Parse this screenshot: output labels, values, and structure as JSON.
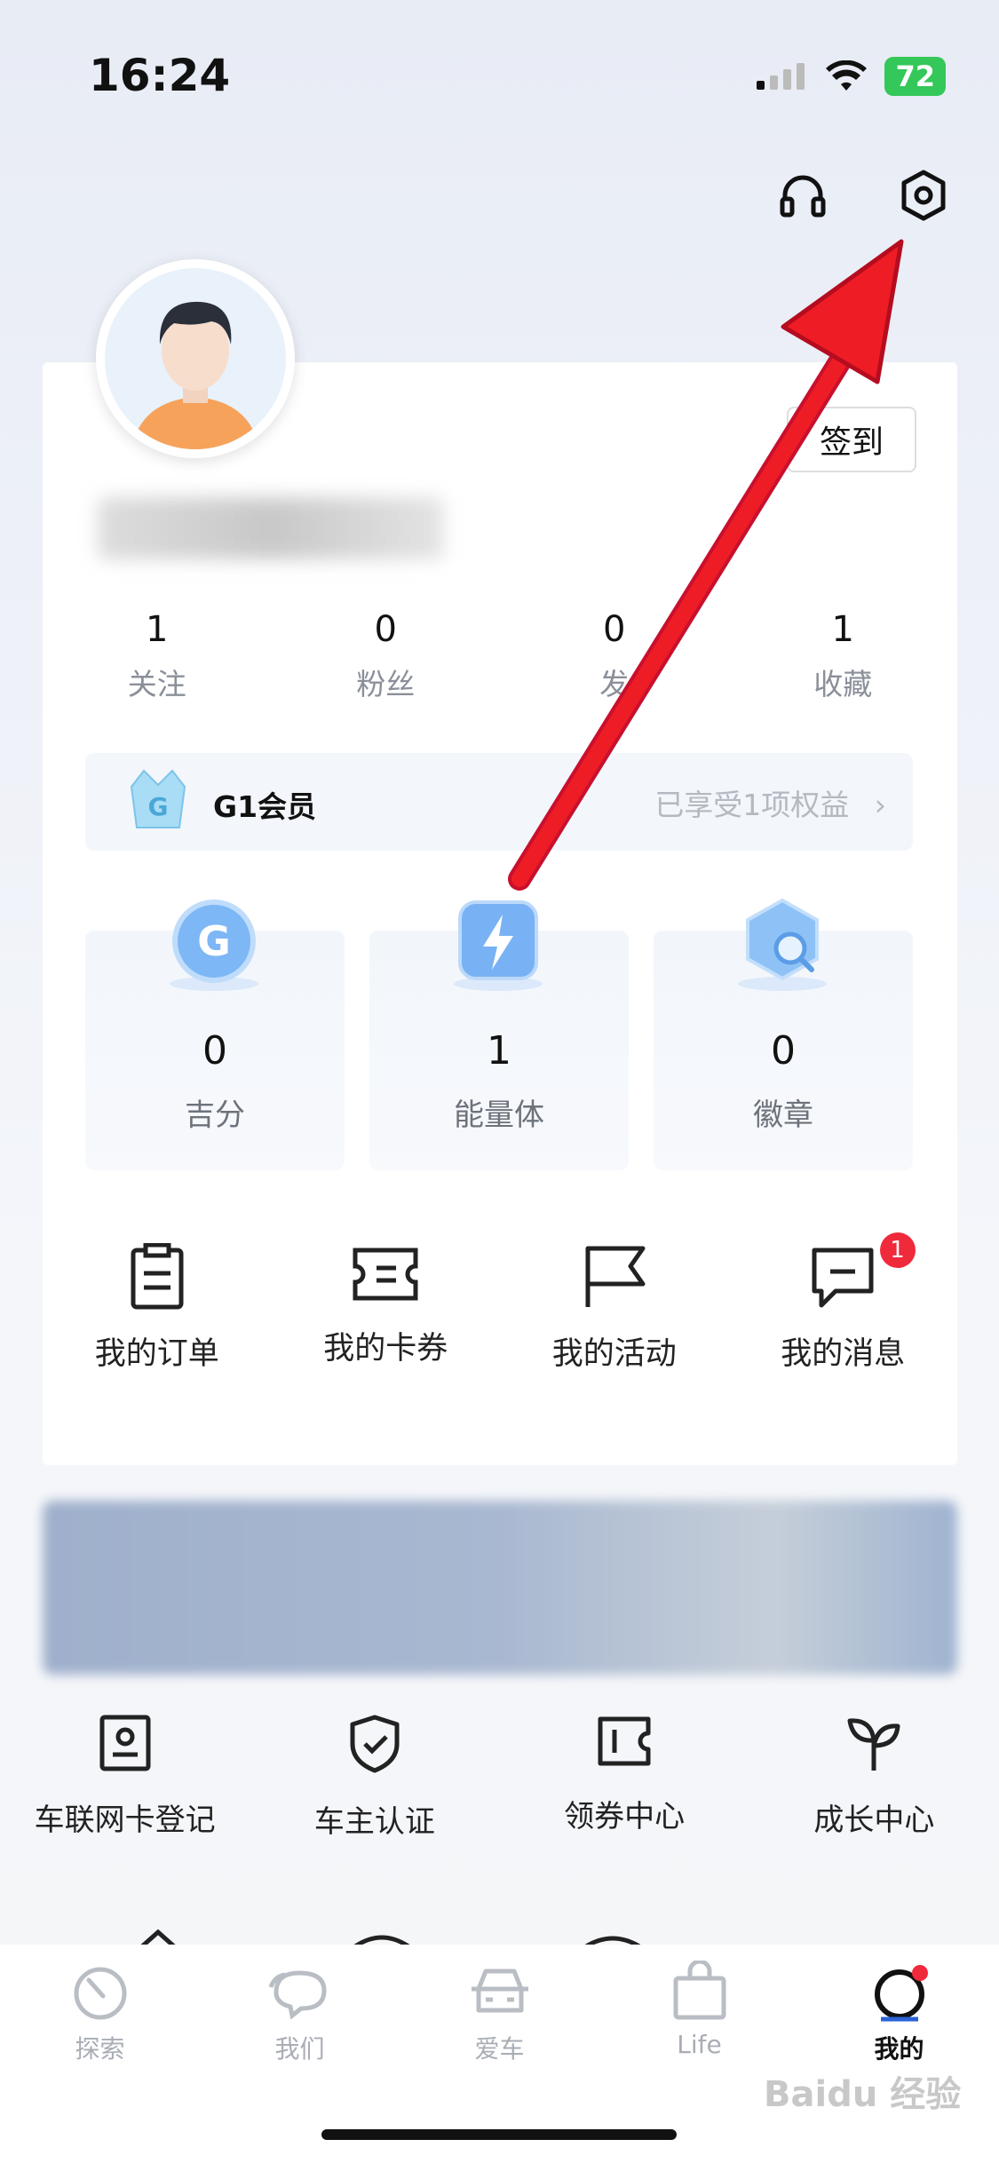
{
  "status_bar": {
    "time": "16:24",
    "battery": "72"
  },
  "header": {
    "support_icon": "headphones-icon",
    "settings_icon": "gear-icon"
  },
  "profile": {
    "signin_label": "签到"
  },
  "stats": [
    {
      "num": "1",
      "label": "关注"
    },
    {
      "num": "0",
      "label": "粉丝"
    },
    {
      "num": "0",
      "label": "发"
    },
    {
      "num": "1",
      "label": "收藏"
    }
  ],
  "member": {
    "title": "G1会员",
    "benefit": "已享受1项权益"
  },
  "tiles": [
    {
      "num": "0",
      "label": "吉分",
      "icon": "g-coin-icon"
    },
    {
      "num": "1",
      "label": "能量体",
      "icon": "energy-icon"
    },
    {
      "num": "0",
      "label": "徽章",
      "icon": "badge-icon"
    }
  ],
  "actions": [
    {
      "label": "我的订单",
      "icon": "clipboard-icon"
    },
    {
      "label": "我的卡券",
      "icon": "ticket-icon"
    },
    {
      "label": "我的活动",
      "icon": "flag-icon"
    },
    {
      "label": "我的消息",
      "icon": "message-icon",
      "badge": "1"
    }
  ],
  "services": [
    {
      "label": "车联网卡登记",
      "icon": "id-card-icon"
    },
    {
      "label": "车主认证",
      "icon": "shield-check-icon"
    },
    {
      "label": "领券中心",
      "icon": "coupon-icon"
    },
    {
      "label": "成长中心",
      "icon": "sprout-icon"
    }
  ],
  "tabs": [
    {
      "label": "探索",
      "icon": "compass-icon"
    },
    {
      "label": "我们",
      "icon": "chat-icon"
    },
    {
      "label": "爱车",
      "icon": "car-icon"
    },
    {
      "label": "Life",
      "icon": "bag-icon"
    },
    {
      "label": "我的",
      "icon": "profile-ring-icon",
      "active": true
    }
  ],
  "watermark": "Baidu 经验"
}
